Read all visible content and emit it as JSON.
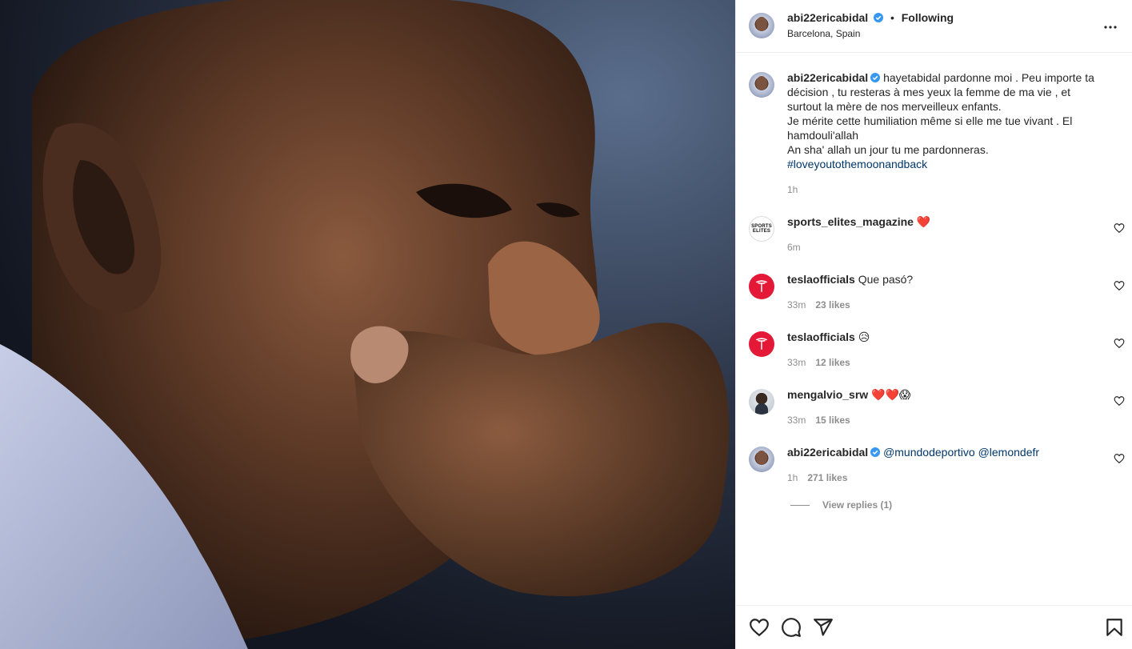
{
  "post": {
    "author": "abi22ericabidal",
    "verified": true,
    "dot": "•",
    "follow_state": "Following",
    "location": "Barcelona, Spain",
    "more_icon": "more-horizontal-icon"
  },
  "caption": {
    "user": "abi22ericabidal",
    "lines": [
      "hayetabidal pardonne moi . Peu importe ta décision , tu resteras à mes yeux la femme de ma vie , et surtout la mère de nos merveilleux enfants.",
      "Je mérite cette humiliation même si elle me tue vivant . El hamdouli'allah",
      "An sha' allah un jour tu me pardonneras."
    ],
    "hashtag": "#loveyoutothemoonandback",
    "time": "1h"
  },
  "comments": [
    {
      "user": "sports_elites_magazine",
      "text": "",
      "emoji": "❤️",
      "time": "6m",
      "likes": "",
      "avatar": "SPORTS ELITES"
    },
    {
      "user": "teslaofficials",
      "text": "Que pasó?",
      "emoji": "",
      "time": "33m",
      "likes": "23 likes"
    },
    {
      "user": "teslaofficials",
      "text": "",
      "emoji": "😥",
      "time": "33m",
      "likes": "12 likes"
    },
    {
      "user": "mengalvio_srw",
      "text": "",
      "emoji": "❤️❤️😱",
      "time": "33m",
      "likes": "15 likes"
    },
    {
      "user": "abi22ericabidal",
      "text": "",
      "mentions": "@mundodeportivo @lemondefr",
      "time": "1h",
      "likes": "271 likes",
      "view_replies": "View replies (1)"
    }
  ],
  "actions": {
    "like_icon": "heart-icon",
    "comment_icon": "comment-icon",
    "share_icon": "paper-plane-icon",
    "save_icon": "bookmark-icon"
  },
  "colors": {
    "link": "#00376b",
    "verified": "#3897f0",
    "muted": "#8e8e8e",
    "tesla": "#e31937"
  }
}
